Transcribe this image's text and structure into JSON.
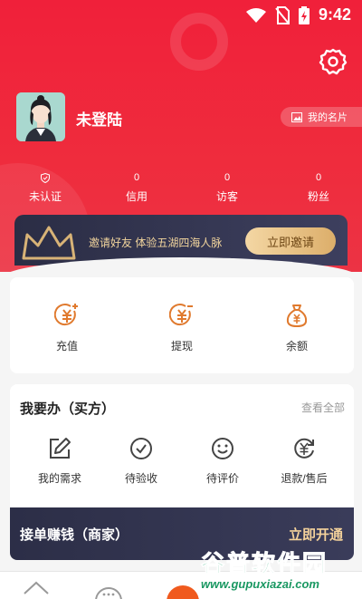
{
  "status": {
    "time": "9:42"
  },
  "user": {
    "name": "未登陆",
    "card_label": "我的名片"
  },
  "stats": [
    {
      "num": "",
      "label": "未认证"
    },
    {
      "num": "0",
      "label": "信用"
    },
    {
      "num": "0",
      "label": "访客"
    },
    {
      "num": "0",
      "label": "粉丝"
    }
  ],
  "invite": {
    "text": "邀请好友 体验五湖四海人脉",
    "button": "立即邀请"
  },
  "wallet": [
    {
      "icon": "recharge-icon",
      "label": "充值"
    },
    {
      "icon": "withdraw-icon",
      "label": "提现"
    },
    {
      "icon": "balance-icon",
      "label": "余额"
    }
  ],
  "todo": {
    "title": "我要办（买方）",
    "more": "查看全部",
    "items": [
      {
        "icon": "edit-icon",
        "label": "我的需求"
      },
      {
        "icon": "check-circle-icon",
        "label": "待验收"
      },
      {
        "icon": "smile-icon",
        "label": "待评价"
      },
      {
        "icon": "refund-icon",
        "label": "退款/售后"
      }
    ]
  },
  "merchant": {
    "title": "接单赚钱（商家）",
    "action": "立即开通"
  },
  "watermark": {
    "title": "谷普软件园",
    "url": "www.gupuxiazai.com"
  },
  "colors": {
    "primary": "#f0203a",
    "gold": "#e9c58a",
    "dark": "#2c2e47",
    "icon_orange": "#e07a2e"
  }
}
